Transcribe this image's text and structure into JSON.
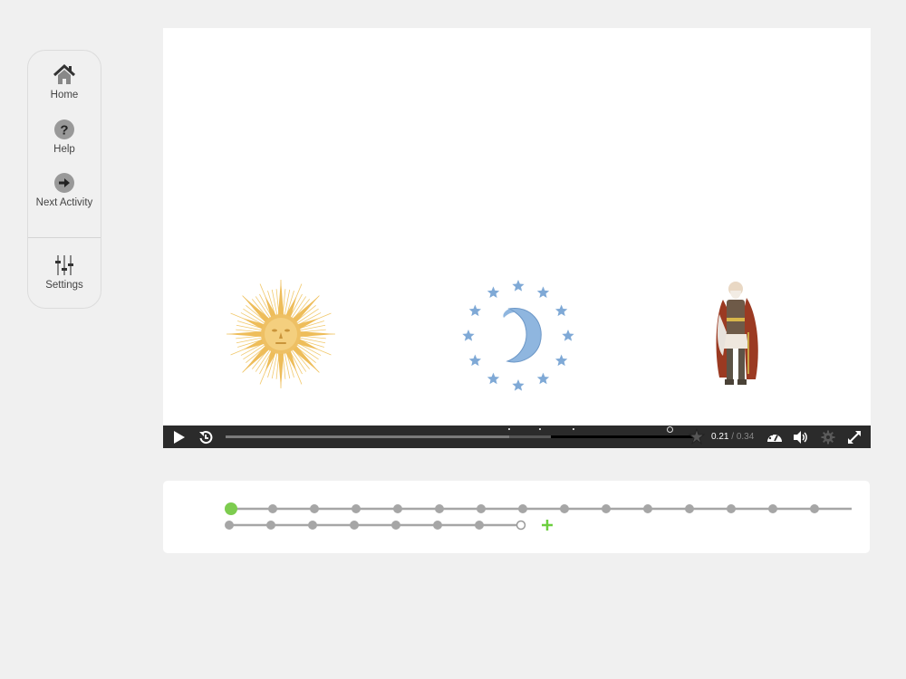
{
  "sidebar": {
    "items": [
      {
        "id": "home",
        "label": "Home",
        "icon": "home-icon"
      },
      {
        "id": "help",
        "label": "Help",
        "icon": "help-icon"
      },
      {
        "id": "next",
        "label": "Next Activity",
        "icon": "arrow-right-icon"
      },
      {
        "id": "settings",
        "label": "Settings",
        "icon": "sliders-icon"
      }
    ]
  },
  "stage": {
    "images": [
      {
        "name": "sun",
        "description": "Golden sun with face"
      },
      {
        "name": "moon",
        "description": "Crescent moon surrounded by stars"
      },
      {
        "name": "warrior",
        "description": "Bearded warrior with red cloak and sword"
      }
    ]
  },
  "player": {
    "current_time": "0.21",
    "separator": " / ",
    "duration": "0.34",
    "played_fraction": 0.6,
    "buffered_fraction": 0.69,
    "marker_fractions": [
      0.598,
      0.665,
      0.736
    ],
    "circle_marker_fraction": 0.94,
    "colors": {
      "bar": "#2b2b2b",
      "played": "#7a7a7a"
    }
  },
  "timeline": {
    "rows": [
      {
        "dots": 15,
        "active_index": 0,
        "line_extends": true
      },
      {
        "dots": 7,
        "hollow_end": true,
        "add_button": true
      }
    ],
    "colors": {
      "active": "#7dcc4f",
      "dot": "#a6a6a6",
      "add": "#6ccf3f"
    }
  }
}
